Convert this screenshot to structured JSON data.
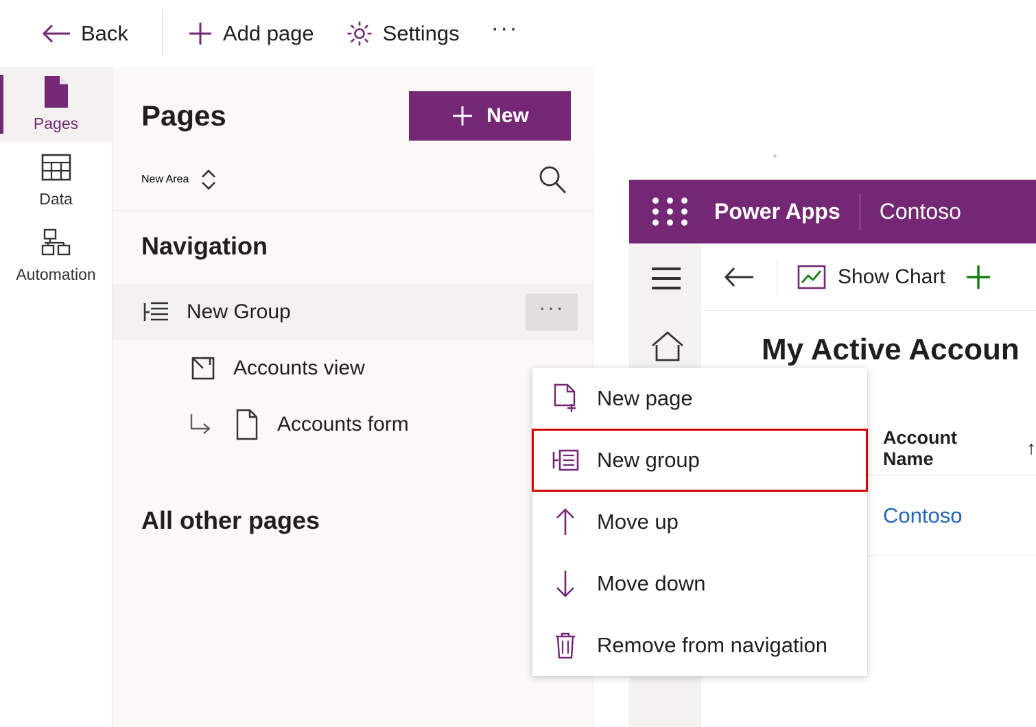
{
  "topbar": {
    "back_label": "Back",
    "add_page_label": "Add page",
    "settings_label": "Settings",
    "more_label": "···"
  },
  "rail": {
    "items": [
      {
        "label": "Pages",
        "icon": "page-icon",
        "active": true
      },
      {
        "label": "Data",
        "icon": "table-icon",
        "active": false
      },
      {
        "label": "Automation",
        "icon": "automation-icon",
        "active": false
      }
    ]
  },
  "pages_panel": {
    "title": "Pages",
    "new_button": "New",
    "area_name": "New Area",
    "search_icon": "search-icon",
    "navigation_title": "Navigation",
    "nav_items": [
      {
        "label": "New Group",
        "icon": "group-icon",
        "indent": 0,
        "selected": true
      },
      {
        "label": "Accounts view",
        "icon": "view-icon",
        "indent": 1,
        "selected": false
      },
      {
        "label": "Accounts form",
        "icon": "form-icon",
        "indent": 2,
        "selected": false
      }
    ],
    "row_more": "···",
    "all_other_pages_title": "All other pages"
  },
  "context_menu": {
    "items": [
      {
        "label": "New page",
        "icon": "new-page-icon",
        "highlighted": false
      },
      {
        "label": "New group",
        "icon": "new-group-icon",
        "highlighted": true
      },
      {
        "label": "Move up",
        "icon": "arrow-up-icon",
        "highlighted": false
      },
      {
        "label": "Move down",
        "icon": "arrow-down-icon",
        "highlighted": false
      },
      {
        "label": "Remove from navigation",
        "icon": "trash-icon",
        "highlighted": false
      }
    ],
    "highlight_color": "#d40000"
  },
  "app_preview": {
    "brand": "Power Apps",
    "environment": "Contoso",
    "waffle_icon": "waffle-icon",
    "hamburger_icon": "hamburger-icon",
    "home_icon": "home-icon",
    "back_icon": "back-arrow-icon",
    "show_chart_label": "Show Chart",
    "new_record_icon": "plus-icon",
    "view_title": "My Active Accoun",
    "grid": {
      "columns": [
        "Account Name"
      ],
      "sort_glyph": "↑",
      "rows": [
        [
          "Contoso"
        ]
      ]
    }
  },
  "colors": {
    "brand": "#742774",
    "panel_bg": "#faf9f8",
    "link": "#2266bb",
    "green": "#107c10"
  }
}
